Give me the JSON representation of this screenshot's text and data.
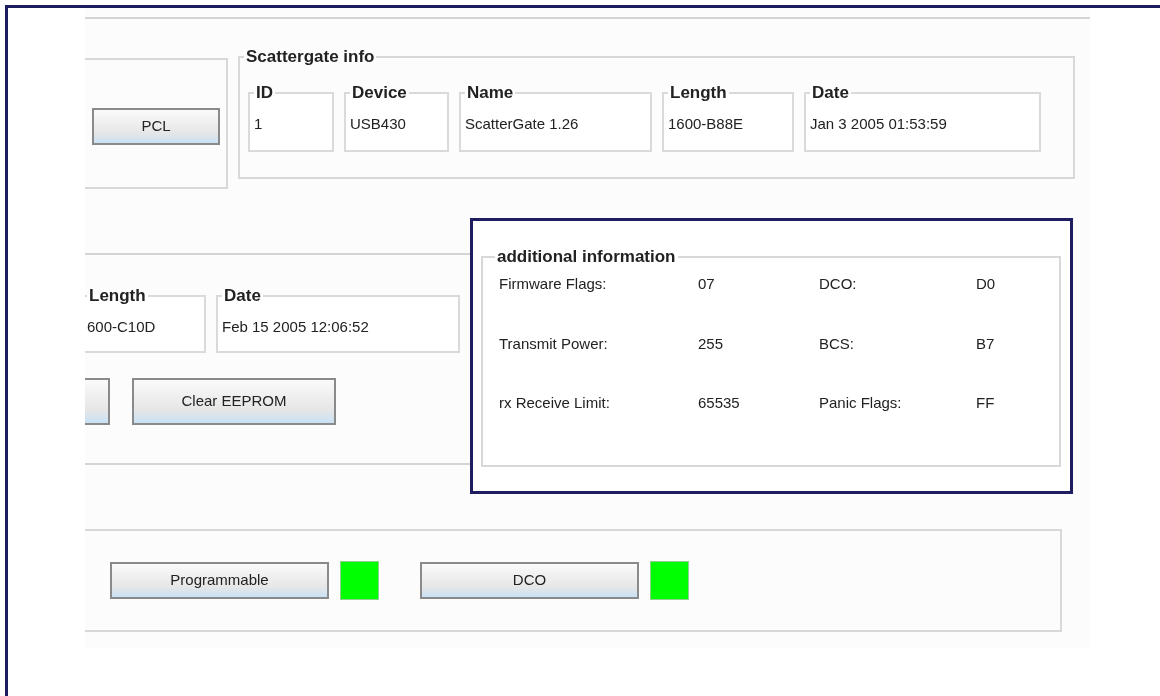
{
  "left_group": {
    "buttons": [
      {
        "label": "PCL"
      }
    ]
  },
  "scattergate_info": {
    "title": "Scattergate info",
    "fields": [
      {
        "label": "ID",
        "value": "1"
      },
      {
        "label": "Device",
        "value": "USB430"
      },
      {
        "label": "Name",
        "value": "ScatterGate 1.26"
      },
      {
        "label": "Length",
        "value": "1600-B88E"
      },
      {
        "label": "Date",
        "value": "Jan 3 2005 01:53:59"
      }
    ]
  },
  "firmware_info": {
    "fields": [
      {
        "label": "Length",
        "value": "600-C10D"
      },
      {
        "label": "Date",
        "value": "Feb 15 2005 12:06:52"
      }
    ],
    "buttons": [
      {
        "kind": "partial"
      },
      {
        "kind": "full",
        "label": "Clear EEPROM"
      }
    ]
  },
  "additional_information": {
    "title": "additional information",
    "entries": [
      {
        "label": "Firmware Flags:",
        "value": "07"
      },
      {
        "label": "DCO:",
        "value": "D0"
      },
      {
        "label": "Transmit Power:",
        "value": "255"
      },
      {
        "label": "BCS:",
        "value": "B7"
      },
      {
        "label": "rx Receive Limit:",
        "value": "65535"
      },
      {
        "label": "Panic Flags:",
        "value": "FF"
      }
    ]
  },
  "status": {
    "items": [
      {
        "label": "Programmable",
        "color": "#00ff00"
      },
      {
        "label": "DCO",
        "color": "#00ff00"
      }
    ]
  }
}
